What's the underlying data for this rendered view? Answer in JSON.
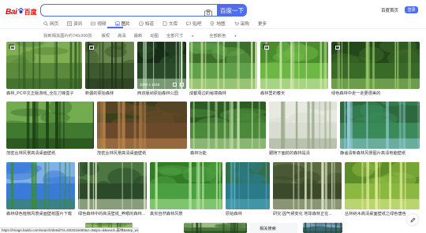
{
  "header": {
    "logo_text": "Bai",
    "logo_du": "百度",
    "search_value": "",
    "search_button": "百度一下",
    "home_link": "百度首页",
    "login": "登录"
  },
  "nav": {
    "tabs": [
      {
        "label": "网页",
        "icon": "search-icon"
      },
      {
        "label": "资讯",
        "icon": "news-icon"
      },
      {
        "label": "视频",
        "icon": "video-icon"
      },
      {
        "label": "图片",
        "icon": "image-icon",
        "active": true
      },
      {
        "label": "知道",
        "icon": "question-icon"
      },
      {
        "label": "文库",
        "icon": "document-icon"
      },
      {
        "label": "贴吧",
        "icon": "forum-icon"
      },
      {
        "label": "地图",
        "icon": "map-icon"
      },
      {
        "label": "采购",
        "icon": "cart-icon"
      },
      {
        "label": "更多",
        "icon": ""
      }
    ]
  },
  "filter": {
    "result_count": "找到相关图片约749,000张",
    "items": [
      "版权",
      "高清",
      "最新",
      "动图",
      "全部尺寸",
      "全部颜色"
    ]
  },
  "images": [
    {
      "caption": "森林_PC中文正版游戏_全在刀锋盒子",
      "palette": [
        "#5a8a3a",
        "#2f5a24",
        "#8fbf5a"
      ],
      "badge": true
    },
    {
      "caption": "新疆的原始森林",
      "palette": [
        "#3e5a2e",
        "#1f3018",
        "#7a9a5a"
      ],
      "badge": true
    },
    {
      "caption": "西双版纳原始森林公园",
      "palette": [
        "#2a4a2a",
        "#c8e8c0",
        "#0f2010"
      ],
      "badge": false,
      "size_label": "1080 x 1445"
    },
    {
      "caption": "成都周边的秘境森林",
      "palette": [
        "#5fa048",
        "#cfe8a0",
        "#2d5a20"
      ],
      "badge": false
    },
    {
      "caption": "森林里的春天",
      "palette": [
        "#6db845",
        "#e0f0c0",
        "#3a7a22"
      ],
      "badge": true
    },
    {
      "caption": "绿色森林中走一走更很美的",
      "palette": [
        "#3a6a28",
        "#a0d070",
        "#1d3a14"
      ],
      "badge": true
    },
    {
      "caption": "茂密丛林风景高清桌面壁纸",
      "palette": [
        "#3f7a30",
        "#1a3a12",
        "#8ac060"
      ],
      "badge": false
    },
    {
      "caption": "茂密丛林风景高清桌面壁纸",
      "palette": [
        "#6a4a2a",
        "#c08850",
        "#2a3a1a"
      ],
      "badge": false
    },
    {
      "caption": "森林功能",
      "palette": [
        "#4a8a3a",
        "#c8e0b0",
        "#1e4a18"
      ],
      "badge": false
    },
    {
      "caption": "跟随下面前的森林是清",
      "palette": [
        "#d8ddd0",
        "#9aa88a",
        "#f0efe8"
      ],
      "badge": false
    },
    {
      "caption": "静谧清新森林风景图片高清电脑壁纸",
      "palette": [
        "#3a8a5a",
        "#9ad0e0",
        "#2a5a30"
      ],
      "badge": false
    },
    {
      "caption": "森林绿色植物风景桌面壁纸图片下载",
      "palette": [
        "#3a7ad8",
        "#3a8a38",
        "#a0c8f0"
      ],
      "badge": false
    },
    {
      "caption": "绿色森林中的高清壁纸_养眼的森林美景",
      "palette": [
        "#2a4a2a",
        "#e8f0d0",
        "#5a8a4a"
      ],
      "badge": false
    },
    {
      "caption": "真实自然森林风景",
      "palette": [
        "#4aa040",
        "#b8e8a0",
        "#2a6a20"
      ],
      "badge": false
    },
    {
      "caption": "原始森林",
      "palette": [
        "#2a7a8a",
        "#5ab0c0",
        "#3a6a30"
      ],
      "badge": false
    },
    {
      "caption": "研究:因气候变化 地球森林正在...",
      "palette": [
        "#3a4a2a",
        "#d8e0c0",
        "#6a7a4a"
      ],
      "badge": false
    },
    {
      "caption": "丛林树木高清桌面壁纸之绿色唐色",
      "palette": [
        "#8ab840",
        "#e8f0a0",
        "#4a7a20"
      ],
      "badge": false
    }
  ],
  "status_url": "https://image.baidu.com/search/detail?ct=503316480&z=0&ipn=d&word=森林&step_word=&hs=0&pn=1&spn=0&di=7&pi=0&rn=1&tn=baiduimagedetail",
  "related_search": "相关搜索"
}
